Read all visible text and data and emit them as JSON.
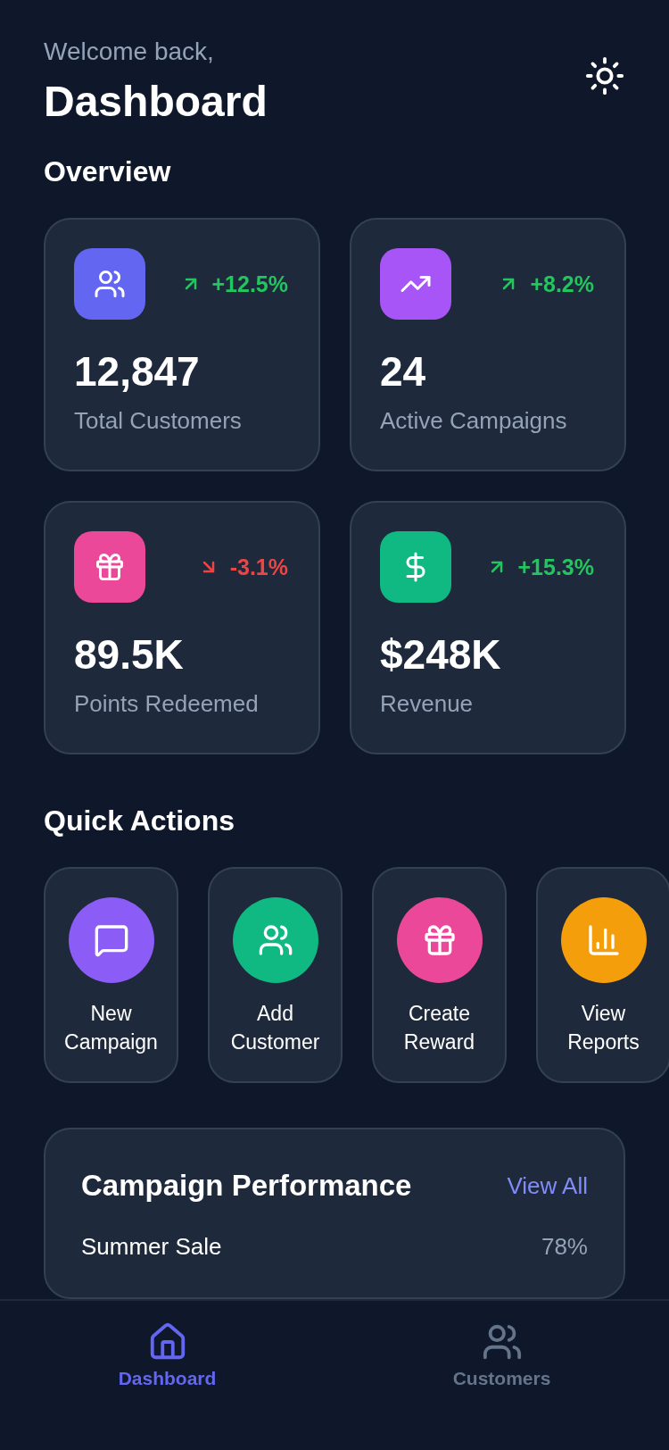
{
  "header": {
    "greeting": "Welcome back,",
    "title": "Dashboard"
  },
  "overview": {
    "title": "Overview",
    "stats": [
      {
        "value": "12,847",
        "label": "Total Customers",
        "change": "+12.5%",
        "kind": "up",
        "color": "#6366f1"
      },
      {
        "value": "24",
        "label": "Active Campaigns",
        "change": "+8.2%",
        "kind": "up",
        "color": "#a855f7"
      },
      {
        "value": "89.5K",
        "label": "Points Redeemed",
        "change": "-3.1%",
        "kind": "down",
        "color": "#ec4899"
      },
      {
        "value": "$248K",
        "label": "Revenue",
        "change": "+15.3%",
        "kind": "up",
        "color": "#10b981"
      }
    ]
  },
  "quick_actions": {
    "title": "Quick Actions",
    "items": [
      {
        "label": "New Campaign",
        "color": "#8b5cf6"
      },
      {
        "label": "Add Customer",
        "color": "#10b981"
      },
      {
        "label": "Create Reward",
        "color": "#ec4899"
      },
      {
        "label": "View Reports",
        "color": "#f59e0b"
      }
    ]
  },
  "campaign_performance": {
    "title": "Campaign Performance",
    "link": "View All",
    "rows": [
      {
        "name": "Summer Sale",
        "value": "78%"
      }
    ]
  },
  "bottom_nav": [
    {
      "label": "Dashboard",
      "selected": true
    },
    {
      "label": "Customers",
      "selected": false
    }
  ]
}
